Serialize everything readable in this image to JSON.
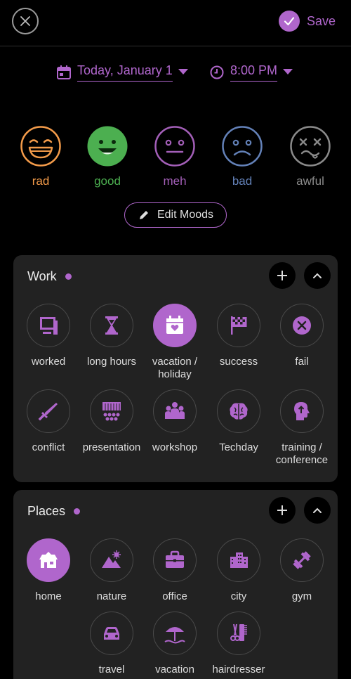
{
  "header": {
    "save_label": "Save"
  },
  "entry": {
    "date": "Today, January 1",
    "time": "8:00 PM"
  },
  "moods": [
    {
      "label": "rad",
      "color": "#f39b4a"
    },
    {
      "label": "good",
      "color": "#4caf50"
    },
    {
      "label": "meh",
      "color": "#a35fb8"
    },
    {
      "label": "bad",
      "color": "#6381b8"
    },
    {
      "label": "awful",
      "color": "#8a8a8a"
    }
  ],
  "edit_moods_label": "Edit Moods",
  "accent": "#b066cc",
  "groups": {
    "work": {
      "title": "Work",
      "items": [
        {
          "label": "worked",
          "icon": "monitor-icon",
          "selected": false
        },
        {
          "label": "long hours",
          "icon": "hourglass-icon",
          "selected": false
        },
        {
          "label": "vacation / holiday",
          "icon": "calendar-heart-icon",
          "selected": true
        },
        {
          "label": "success",
          "icon": "checkered-flag-icon",
          "selected": false
        },
        {
          "label": "fail",
          "icon": "x-circle-icon",
          "selected": false
        },
        {
          "label": "conflict",
          "icon": "sword-icon",
          "selected": false
        },
        {
          "label": "presentation",
          "icon": "stage-audience-icon",
          "selected": false
        },
        {
          "label": "workshop",
          "icon": "group-icon",
          "selected": false
        },
        {
          "label": "Techday",
          "icon": "brain-icon",
          "selected": false
        },
        {
          "label": "training / conference",
          "icon": "head-arrow-icon",
          "selected": false
        }
      ]
    },
    "places": {
      "title": "Places",
      "items": [
        {
          "label": "home",
          "icon": "house-icon",
          "selected": true
        },
        {
          "label": "nature",
          "icon": "mountain-sun-icon",
          "selected": false
        },
        {
          "label": "office",
          "icon": "briefcase-icon",
          "selected": false
        },
        {
          "label": "city",
          "icon": "buildings-icon",
          "selected": false
        },
        {
          "label": "gym",
          "icon": "dumbbell-icon",
          "selected": false
        },
        {
          "label": "travel",
          "icon": "car-icon",
          "selected": false
        },
        {
          "label": "vacation",
          "icon": "beach-umbrella-icon",
          "selected": false
        },
        {
          "label": "hairdresser",
          "icon": "comb-scissors-icon",
          "selected": false
        }
      ]
    }
  }
}
